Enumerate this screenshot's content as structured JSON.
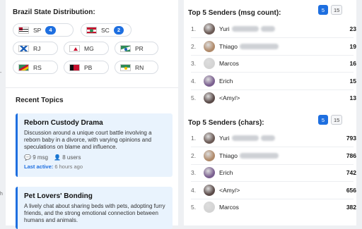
{
  "states": {
    "title": "Brazil State Distribution:",
    "items": [
      {
        "code": "SP",
        "count": "4",
        "flag": "sp"
      },
      {
        "code": "SC",
        "count": "2",
        "flag": "sc"
      },
      {
        "code": "RJ",
        "count": null,
        "flag": "rj"
      },
      {
        "code": "MG",
        "count": null,
        "flag": "mg"
      },
      {
        "code": "PR",
        "count": null,
        "flag": "pr"
      },
      {
        "code": "RS",
        "count": null,
        "flag": "rs"
      },
      {
        "code": "PB",
        "count": null,
        "flag": "pb"
      },
      {
        "code": "RN",
        "count": null,
        "flag": "rn"
      }
    ]
  },
  "recent_topics": {
    "title": "Recent Topics",
    "last_active_label": "Last active:",
    "cards": [
      {
        "title": "Reborn Custody Drama",
        "description": "Discussion around a unique court battle involving a reborn baby in a divorce, with varying opinions and speculations on blame and influence.",
        "msgs": "9 msg",
        "users": "8 users",
        "last_active": "6 hours ago"
      },
      {
        "title": "Pet Lovers' Bonding",
        "description": "A lively chat about sharing beds with pets, adopting furry friends, and the strong emotional connection between humans and animals."
      }
    ]
  },
  "top_msg": {
    "title": "Top 5 Senders (msg count):",
    "toggle": [
      "5",
      "15"
    ],
    "active": "5",
    "rows": [
      {
        "rank": "1.",
        "name": "Yuri",
        "value": "23",
        "avatar": "#6b5a55"
      },
      {
        "rank": "2.",
        "name": "Thiago",
        "value": "19",
        "avatar": "#b08a6a"
      },
      {
        "rank": "3.",
        "name": "Marcos",
        "value": "16",
        "avatar": "#d4d4d4"
      },
      {
        "rank": "4.",
        "name": "Erich",
        "value": "15",
        "avatar": "#7a5f8f"
      },
      {
        "rank": "5.",
        "name": "<Amy/>",
        "value": "13",
        "avatar": "#5a4a48"
      }
    ]
  },
  "top_chars": {
    "title": "Top 5 Senders (chars):",
    "toggle": [
      "5",
      "15"
    ],
    "active": "5",
    "rows": [
      {
        "rank": "1.",
        "name": "Yuri",
        "value": "793",
        "avatar": "#6b5a55"
      },
      {
        "rank": "2.",
        "name": "Thiago",
        "value": "786",
        "avatar": "#b08a6a"
      },
      {
        "rank": "3.",
        "name": "Erich",
        "value": "742",
        "avatar": "#7a5f8f"
      },
      {
        "rank": "4.",
        "name": "<Amy/>",
        "value": "656",
        "avatar": "#5a4a48"
      },
      {
        "rank": "5.",
        "name": "Marcos",
        "value": "382",
        "avatar": "#d4d4d4"
      }
    ]
  },
  "colors": {
    "accent": "#1e6fe0",
    "card_bg": "#e9f3fd"
  }
}
